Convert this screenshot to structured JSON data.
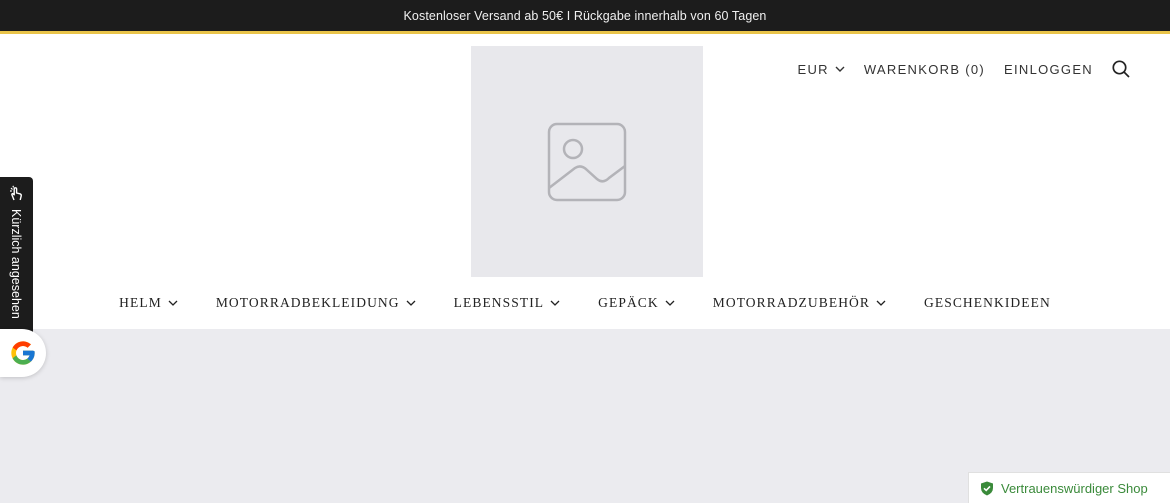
{
  "announcement": {
    "text": "Kostenloser Versand ab 50€ I Rückgabe innerhalb von 60 Tagen"
  },
  "header": {
    "currency": "EUR",
    "cart": "WARENKORB (0)",
    "login": "EINLOGGEN",
    "icons": {
      "currency_chevron": "chevron-down-icon",
      "search": "search-icon",
      "logo": "image-placeholder-icon"
    }
  },
  "nav": {
    "items": [
      {
        "label": "HELM",
        "has_dropdown": true
      },
      {
        "label": "MOTORRADBEKLEIDUNG",
        "has_dropdown": true
      },
      {
        "label": "LEBENSSTIL",
        "has_dropdown": true
      },
      {
        "label": "GEPÄCK",
        "has_dropdown": true
      },
      {
        "label": "MOTORRADZUBEHÖR",
        "has_dropdown": true
      },
      {
        "label": "GESCHENKIDEEN",
        "has_dropdown": false
      }
    ]
  },
  "recently_viewed": {
    "label": "Kürzlich angesehen",
    "icon": "hand-pointer-icon"
  },
  "google_badge": {
    "icon": "google-g-icon"
  },
  "trust_badge": {
    "label": "Vertrauenswürdiger Shop",
    "icon": "shield-check-icon"
  },
  "colors": {
    "announce_bg": "#1c1c1c",
    "announce_border": "#e9c44a",
    "placeholder_bg": "#e8e8ec",
    "content_bg": "#ebebef",
    "trust_green": "#3a8a3a"
  }
}
